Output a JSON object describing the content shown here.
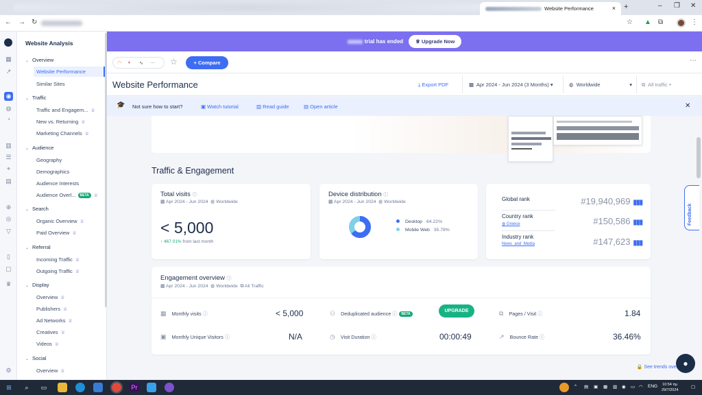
{
  "browser": {
    "tab_title": "Website Performance",
    "tab_close": "×",
    "new_tab": "+",
    "win_min": "–",
    "win_max": "❐",
    "win_close": "✕"
  },
  "banner": {
    "text": "trial has ended",
    "upgrade_label": "Upgrade Now"
  },
  "toolbar": {
    "compare_label": "+ Compare"
  },
  "page": {
    "title": "Website Performance",
    "export_label": "Export PDF",
    "date_range": "Apr 2024 - Jun 2024 (3 Months)",
    "region": "Worldwide",
    "traffic": "All traffic"
  },
  "hint": {
    "question": "Not sure how to start?",
    "tutorial": "Watch tutorial",
    "guide": "Read guide",
    "article": "Open article"
  },
  "sidebar": {
    "title": "Website Analysis",
    "sections": {
      "overview": "Overview",
      "traffic": "Traffic",
      "audience": "Audience",
      "search": "Search",
      "referral": "Referral",
      "display": "Display",
      "social": "Social"
    },
    "items": {
      "website_performance": "Website Performance",
      "similar_sites": "Similar Sites",
      "traffic_engagement": "Traffic and Engagem...",
      "new_returning": "New vs. Returning",
      "marketing_channels": "Marketing Channels",
      "geography": "Geography",
      "demographics": "Demographics",
      "audience_interests": "Audience Interests",
      "audience_overlap": "Audience Overl...",
      "organic_overview": "Organic Overview",
      "paid_overview": "Paid Overview",
      "incoming_traffic": "Incoming Traffic",
      "outgoing_traffic": "Outgoing Traffic",
      "display_overview": "Overview",
      "publishers": "Publishers",
      "ad_networks": "Ad Networks",
      "creatives": "Creatives",
      "videos": "Videos",
      "social_overview": "Overview"
    },
    "beta": "BETA"
  },
  "section_title": "Traffic & Engagement",
  "total_visits": {
    "title": "Total visits",
    "period": "Apr 2024 - Jun 2024",
    "region": "Worldwide",
    "value": "< 5,000",
    "growth": "↑ 467.01%",
    "growth_note": "from last month"
  },
  "device": {
    "title": "Device distribution",
    "period": "Apr 2024 - Jun 2024",
    "region": "Worldwide",
    "desktop_label": "Desktop",
    "desktop_pct": "64.22%",
    "mobile_label": "Mobile Web",
    "mobile_pct": "35.78%",
    "desktop_share": 64.22,
    "desktop_color": "#3d6df2",
    "mobile_color": "#7fd0e8"
  },
  "ranks": {
    "global_label": "Global rank",
    "global_value": "#19,940,969",
    "country_label": "Country rank",
    "country_sub": "Greece",
    "country_value": "#150,586",
    "industry_label": "Industry rank",
    "industry_sub": "News_and_Media",
    "industry_value": "#147,623"
  },
  "engagement": {
    "title": "Engagement overview",
    "period": "Apr 2024 - Jun 2024",
    "region": "Worldwide",
    "traffic": "All Traffic",
    "monthly_visits_label": "Monthly visits",
    "monthly_visits_value": "< 5,000",
    "unique_label": "Monthly Unique Visitors",
    "unique_value": "N/A",
    "dedup_label": "Deduplicated audience",
    "upgrade_label": "UPGRADE",
    "duration_label": "Visit Duration",
    "duration_value": "00:00:49",
    "pages_label": "Pages / Visit",
    "pages_value": "1.84",
    "bounce_label": "Bounce Rate",
    "bounce_value": "36.46%",
    "trend_link": "See trends over time"
  },
  "feedback_label": "Feedback",
  "taskbar": {
    "lang": "ENG",
    "time": "10:54 πμ",
    "date": "29/7/2024"
  },
  "colors": {
    "accent": "#3d6df2",
    "banner": "#7c6ff0",
    "success": "#17b384"
  }
}
